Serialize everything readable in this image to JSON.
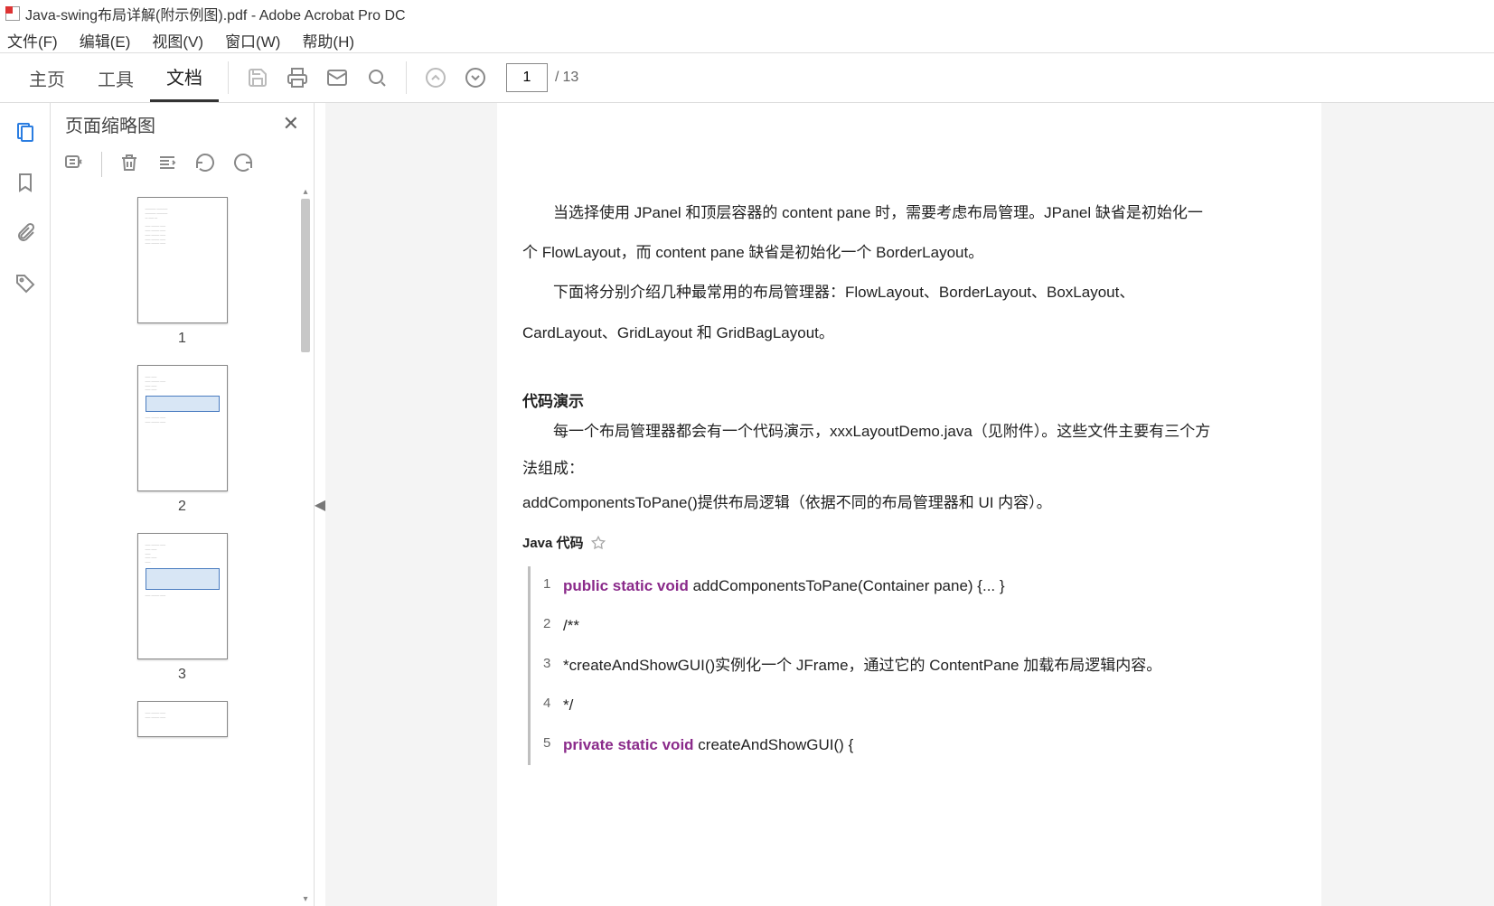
{
  "window": {
    "title": "Java-swing布局详解(附示例图).pdf - Adobe Acrobat Pro DC"
  },
  "menubar": [
    "文件(F)",
    "编辑(E)",
    "视图(V)",
    "窗口(W)",
    "帮助(H)"
  ],
  "toolbar": {
    "tabs": {
      "home": "主页",
      "tools": "工具",
      "document": "文档"
    },
    "page_current": "1",
    "page_total": "13",
    "page_sep": "/ "
  },
  "thumb_panel": {
    "title": "页面缩略图"
  },
  "thumbs": [
    {
      "num": "1"
    },
    {
      "num": "2"
    },
    {
      "num": "3"
    }
  ],
  "doc": {
    "p1": "当选择使用 JPanel 和顶层容器的 content pane 时，需要考虑布局管理。JPanel 缺省是初始化一个 FlowLayout，而 content pane 缺省是初始化一个 BorderLayout。",
    "p2": "下面将分别介绍几种最常用的布局管理器：FlowLayout、BorderLayout、BoxLayout、CardLayout、GridLayout 和 GridBagLayout。",
    "heading": "代码演示",
    "p3": "每一个布局管理器都会有一个代码演示，xxxLayoutDemo.java（见附件）。这些文件主要有三个方法组成：",
    "p4": "addComponentsToPane()提供布局逻辑（依据不同的布局管理器和 UI 内容）。",
    "code_label": "Java 代码",
    "code": [
      {
        "n": "1",
        "pre": "public static void ",
        "mid": "addComponentsToPane(Container pane) {... }",
        "cls": "kw"
      },
      {
        "n": "2",
        "pre": "/**",
        "cls": "com"
      },
      {
        "n": "3",
        "pre": "*createAndShowGUI()实例化一个 JFrame，通过它的 ContentPane 加载布局逻辑内容。",
        "cls": "com"
      },
      {
        "n": "4",
        "pre": "*/",
        "cls": "com"
      },
      {
        "n": "5",
        "pre": "private static void ",
        "mid": "createAndShowGUI() {",
        "cls": "kw"
      }
    ]
  }
}
